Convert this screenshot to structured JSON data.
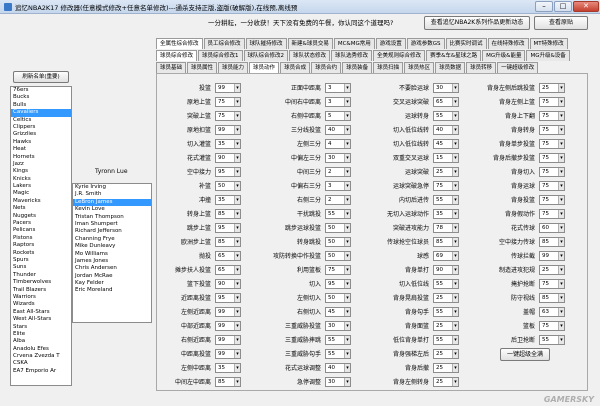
{
  "window": {
    "title": "追忆NBA2K17 修改器(任意模式修改+任意名单修改)---通杀支持正版,盗版(破解版),在线预,离线预",
    "min": "–",
    "max": "□",
    "close": "✕"
  },
  "headline": "一分耕耘，一分收获！天下没有免费的午餐，你认同这个道理吗?",
  "top_buttons": [
    "查看追忆NBA2K系列作品更新动态",
    "查看原贴"
  ],
  "tabs_row1": [
    "全属性综合修改",
    "员工综合修改",
    "球队摧持修改",
    "新建&球员交易",
    "MC&MG常用",
    "游戏设置",
    "游戏参数GS",
    "比赛实时调试",
    "在线特殊修改",
    "MT特殊修改"
  ],
  "tabs_row2": [
    "球员综合修改",
    "球员综合修改1",
    "球队综合修改2",
    "球队状态修改",
    "球队选秀修改",
    "全美规则综合修改",
    "赛季&车&星球之路",
    "MG升级&能量",
    "MG升级&设备"
  ],
  "tabs_row3": [
    "球员基础",
    "球员属性",
    "球员能力",
    "球员动作",
    "球员合成",
    "球员合约",
    "球员装备",
    "球员扫描",
    "球员热区",
    "球员数据",
    "球员转移",
    "一键超级修改"
  ],
  "refresh_label": "刷新名单(重要)",
  "teams": [
    "76ers",
    "Bucks",
    "Bulls",
    "Cavaliers",
    "Celtics",
    "Clippers",
    "Grizzlies",
    "Hawks",
    "Heat",
    "Hornets",
    "Jazz",
    "Kings",
    "Knicks",
    "Lakers",
    "Magic",
    "Mavericks",
    "Nets",
    "Nuggets",
    "Pacers",
    "Pelicans",
    "Pistons",
    "Raptors",
    "Rockets",
    "Spurs",
    "Suns",
    "Thunder",
    "Timberwolves",
    "Trail Blazers",
    "Warriors",
    "Wizards",
    "East All-Stars",
    "West All-Stars",
    "Stars",
    "Elite",
    "Alba",
    "Anadolu Efes",
    "Crvena Zvezda T",
    "CSKA",
    "EA7 Emporio Ar"
  ],
  "selected_team": "Cavaliers",
  "team_label": "Tyronn Lue",
  "players": [
    "Kyrie Irving",
    "J.R. Smith",
    "LeBron James",
    "Kevin Love",
    "Tristan Thompson",
    "Iman Shumpert",
    "Richard Jefferson",
    "Channing Frye",
    "Mike Dunleavy",
    "Mo Williams",
    "James Jones",
    "Chris Andersen",
    "Jordan McRae",
    "Kay Felder",
    "Eric Moreland"
  ],
  "selected_player": "LeBron James",
  "col1": [
    [
      "投篮",
      "99"
    ],
    [
      "原地上篮",
      "75"
    ],
    [
      "突破上篮",
      "75"
    ],
    [
      "原地扣篮",
      "99"
    ],
    [
      "切入灌篮",
      "35"
    ],
    [
      "花式灌篮",
      "90"
    ],
    [
      "空中接力",
      "95"
    ],
    [
      "补篮",
      "50"
    ],
    [
      "冲撞",
      "35"
    ],
    [
      "转身上篮",
      "85"
    ],
    [
      "跳步上篮",
      "95"
    ],
    [
      "欧洲步上篮",
      "85"
    ],
    [
      "抛投",
      "65"
    ],
    [
      "摊步扶人投篮",
      "65"
    ],
    [
      "篮下投篮",
      "90"
    ],
    [
      "近距离投篮",
      "95"
    ],
    [
      "左侧近距离",
      "99"
    ],
    [
      "中部近距离",
      "99"
    ],
    [
      "右侧近距离",
      "99"
    ],
    [
      "中距离投篮",
      "99"
    ],
    [
      "左侧中距离",
      "35"
    ],
    [
      "中间左中距离",
      "85"
    ]
  ],
  "col2": [
    [
      "正面中距离",
      "3"
    ],
    [
      "中间右中距离",
      "3"
    ],
    [
      "右侧中距离",
      "5"
    ],
    [
      "三分线投篮",
      "40"
    ],
    [
      "左侧三分",
      "4"
    ],
    [
      "中偏左三分",
      "30"
    ],
    [
      "中间三分",
      "2"
    ],
    [
      "中偏右三分",
      "3"
    ],
    [
      "右侧三分",
      "2"
    ],
    [
      "干扰跳投",
      "55"
    ],
    [
      "跳步运球投篮",
      "50"
    ],
    [
      "转身跳投",
      "50"
    ],
    [
      "攻防转换中作投篮",
      "50"
    ],
    [
      "利用篮板",
      "75"
    ],
    [
      "切入",
      "95"
    ],
    [
      "左侧切入",
      "50"
    ],
    [
      "右侧切入",
      "45"
    ],
    [
      "三重威胁投篮",
      "30"
    ],
    [
      "三重威胁摔跳",
      "55"
    ],
    [
      "三重威胁勾手",
      "55"
    ],
    [
      "花式运球调整",
      "40"
    ],
    [
      "急停调整",
      "30"
    ]
  ],
  "col3": [
    [
      "不要脸运球",
      "30"
    ],
    [
      "交叉运球突破",
      "65"
    ],
    [
      "运球转身",
      "55"
    ],
    [
      "切入低位线转",
      "40"
    ],
    [
      "切入低位线转",
      "45"
    ],
    [
      "双重交叉运球",
      "15"
    ],
    [
      "运球突破",
      "25"
    ],
    [
      "运球突破急停",
      "75"
    ],
    [
      "内切后进传",
      "55"
    ],
    [
      "无切入运球动作",
      "35"
    ],
    [
      "突破进攻能力",
      "78"
    ],
    [
      "传球抢空位球员",
      "85"
    ],
    [
      "球感",
      "69"
    ],
    [
      "背身单打",
      "90"
    ],
    [
      "切入低位线",
      "55"
    ],
    [
      "背身晃肩投篮",
      "25"
    ],
    [
      "背身勾手",
      "55"
    ],
    [
      "背身面篮",
      "25"
    ],
    [
      "低位背身单打",
      "55"
    ],
    [
      "背身强梯左后",
      "25"
    ],
    [
      "背身后撤",
      "25"
    ],
    [
      "背身左侧转身",
      "25"
    ]
  ],
  "col4": [
    [
      "背身左侧后跳投篮",
      "25"
    ],
    [
      "背身左侧上篮",
      "75"
    ],
    [
      "背身上下翻",
      "75"
    ],
    [
      "背身转身",
      "75"
    ],
    [
      "背身单步投篮",
      "75"
    ],
    [
      "背身后撤步投篮",
      "75"
    ],
    [
      "背身切入",
      "75"
    ],
    [
      "背身运球",
      "75"
    ],
    [
      "背身投篮",
      "75"
    ],
    [
      "背身假动作",
      "75"
    ],
    [
      "花式传球",
      "60"
    ],
    [
      "空中接力传球",
      "85"
    ],
    [
      "传球拦截",
      "99"
    ],
    [
      "制造进攻犯规",
      "25"
    ],
    [
      "掩护抢断",
      "75"
    ],
    [
      "防守视线",
      "85"
    ],
    [
      "盖帽",
      "63"
    ],
    [
      "篮板",
      "75"
    ],
    [
      "后卫抢断",
      "55"
    ]
  ],
  "apply_label": "一键超级全满",
  "watermark": "GAMERSKY"
}
